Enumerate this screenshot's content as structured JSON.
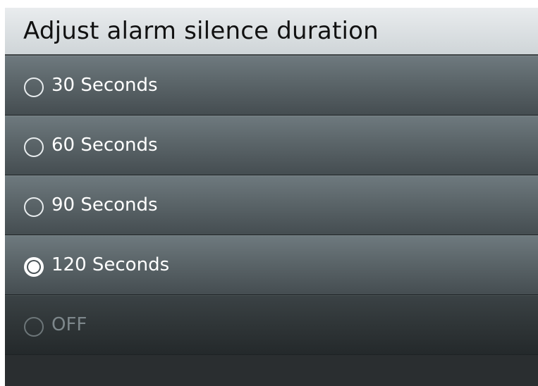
{
  "dialog": {
    "title": "Adjust alarm silence duration"
  },
  "options": [
    {
      "label": "30 Seconds",
      "selected": false,
      "enabled": true
    },
    {
      "label": "60 Seconds",
      "selected": false,
      "enabled": true
    },
    {
      "label": "90 Seconds",
      "selected": false,
      "enabled": true
    },
    {
      "label": "120 Seconds",
      "selected": true,
      "enabled": true
    },
    {
      "label": "OFF",
      "selected": false,
      "enabled": false
    }
  ],
  "colors": {
    "title_bg": "#dde2e4",
    "option_bg": "#5b6569",
    "disabled_bg": "#2f3537",
    "text": "#ffffff",
    "disabled_text": "#7d878b"
  }
}
